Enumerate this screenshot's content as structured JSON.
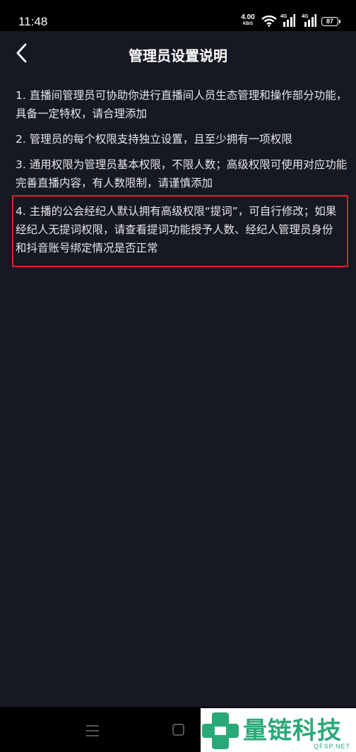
{
  "status_bar": {
    "time": "11:48",
    "speed_value": "4.00",
    "speed_unit": "KB/S",
    "network1": "4G",
    "network2": "4G",
    "battery": "87"
  },
  "header": {
    "title": "管理员设置说明",
    "back_icon": "chevron-left-icon"
  },
  "content": {
    "items": [
      "1. 直播间管理员可协助你进行直播间人员生态管理和操作部分功能，具备一定特权，请合理添加",
      "2. 管理员的每个权限支持独立设置，且至少拥有一项权限",
      "3. 通用权限为管理员基本权限，不限人数；高级权限可使用对应功能完善直播内容，有人数限制，请谨慎添加",
      "4. 主播的公会经纪人默认拥有高级权限“提词”，可自行修改；如果经纪人无提词权限，请查看提词功能授予人数、经纪人管理员身份和抖音账号绑定情况是否正常"
    ]
  },
  "colors": {
    "background": "#161823",
    "highlight_border": "#d9222a",
    "watermark_green": "#2aa978"
  },
  "watermark": {
    "brand": "量链科技",
    "url": "QFSP.NET"
  }
}
